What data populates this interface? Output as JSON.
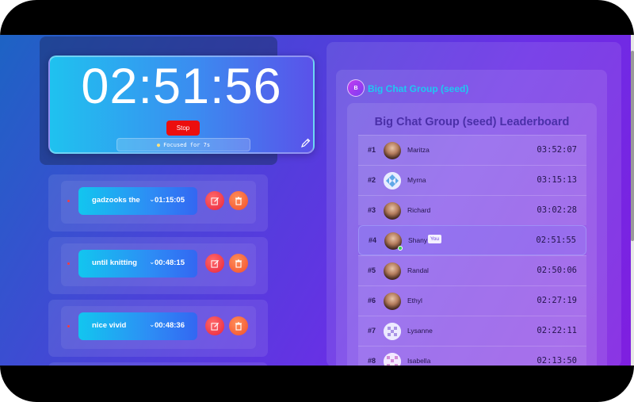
{
  "timer": {
    "display": "02:51:56",
    "stop_label": "Stop",
    "focus_status": "Focused for 7s"
  },
  "tasks": [
    {
      "name": "gadzooks the",
      "time": "01:15:05"
    },
    {
      "name": "until knitting",
      "time": "00:48:15"
    },
    {
      "name": "nice vivid",
      "time": "00:48:36"
    }
  ],
  "group": {
    "badge": "B",
    "name": "Big Chat Group (seed)",
    "leaderboard_title": "Big Chat Group (seed) Leaderboard",
    "you_label": "You"
  },
  "leaderboard": [
    {
      "rank": "#1",
      "name": "Maritza",
      "time": "03:52:07",
      "avatar": "photo"
    },
    {
      "rank": "#2",
      "name": "Myrna",
      "time": "03:15:13",
      "avatar": "pattern"
    },
    {
      "rank": "#3",
      "name": "Richard",
      "time": "03:02:28",
      "avatar": "photo"
    },
    {
      "rank": "#4",
      "name": "Shany",
      "time": "02:51:55",
      "avatar": "photo"
    },
    {
      "rank": "#5",
      "name": "Randal",
      "time": "02:50:06",
      "avatar": "photo"
    },
    {
      "rank": "#6",
      "name": "Ethyl",
      "time": "02:27:19",
      "avatar": "photo"
    },
    {
      "rank": "#7",
      "name": "Lysanne",
      "time": "02:22:11",
      "avatar": "pattern"
    },
    {
      "rank": "#8",
      "name": "Isabella",
      "time": "02:13:50",
      "avatar": "pattern"
    }
  ]
}
